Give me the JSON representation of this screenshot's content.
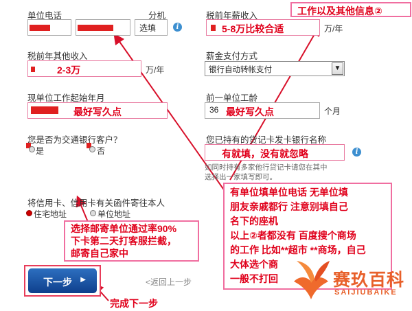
{
  "form": {
    "company_phone_label": "单位电话",
    "extension_label": "分机",
    "extension_placeholder": "选填",
    "pretax_salary_label": "税前年薪收入",
    "pretax_salary_note": "5-8万比较合适",
    "unit_wan_year": "万/年",
    "other_income_label": "税前年其他收入",
    "other_income_note": "2-3万",
    "pay_method_label": "薪金支付方式",
    "pay_method_value": "银行自动转帐支付",
    "start_month_label": "现单位工作起始年月",
    "start_month_note": "最好写久点",
    "prev_tenure_label": "前一单位工龄",
    "prev_tenure_value": "36",
    "prev_tenure_note": "最好写久点",
    "unit_month": "个月",
    "bocom_customer_label": "您是否为交通银行客户？",
    "radio_yes": "是",
    "radio_no": "否",
    "other_bank_label": "您已持有的贷记卡发卡银行名称",
    "other_bank_note": "有就填，没有就忽略",
    "other_bank_hint_1": "如同时持有多家他行贷记卡请您在其中",
    "other_bank_hint_2": "选择出一家填写即可。",
    "mail_label": "将信用卡、信用卡有关函件寄往本人",
    "mail_home": "住宅地址",
    "mail_company": "单位地址",
    "next_button": "下一步",
    "next_arrow": "▶",
    "back_link": "<返回上一步"
  },
  "annotations": {
    "section_title": "工作以及其他信息②",
    "mail_note_1": "选择邮寄单位通过率90%",
    "mail_note_2": "下卡第二天打客服拦截，",
    "mail_note_3": "邮寄自己家中",
    "big_note_1": "有单位填单位电话 无单位填",
    "big_note_2": "朋友亲戚都行 注意别填自己",
    "big_note_3": "名下的座机",
    "big_note_4": "以上②者都没有 百度搜个商场",
    "big_note_5": "的工作 比如**超市 **商场，自己",
    "big_note_6": "大体选个商",
    "big_note_7": "一般不打回",
    "finish_note": "完成下一步"
  },
  "watermark": {
    "cn": "赛玖百科",
    "en": "SAIJIUBAIKE"
  },
  "colors": {
    "annotation_red": "#e0001b",
    "annotation_pink": "#f06ea0",
    "button_blue": "#1a52a6",
    "logo_orange": "#e8602a"
  }
}
